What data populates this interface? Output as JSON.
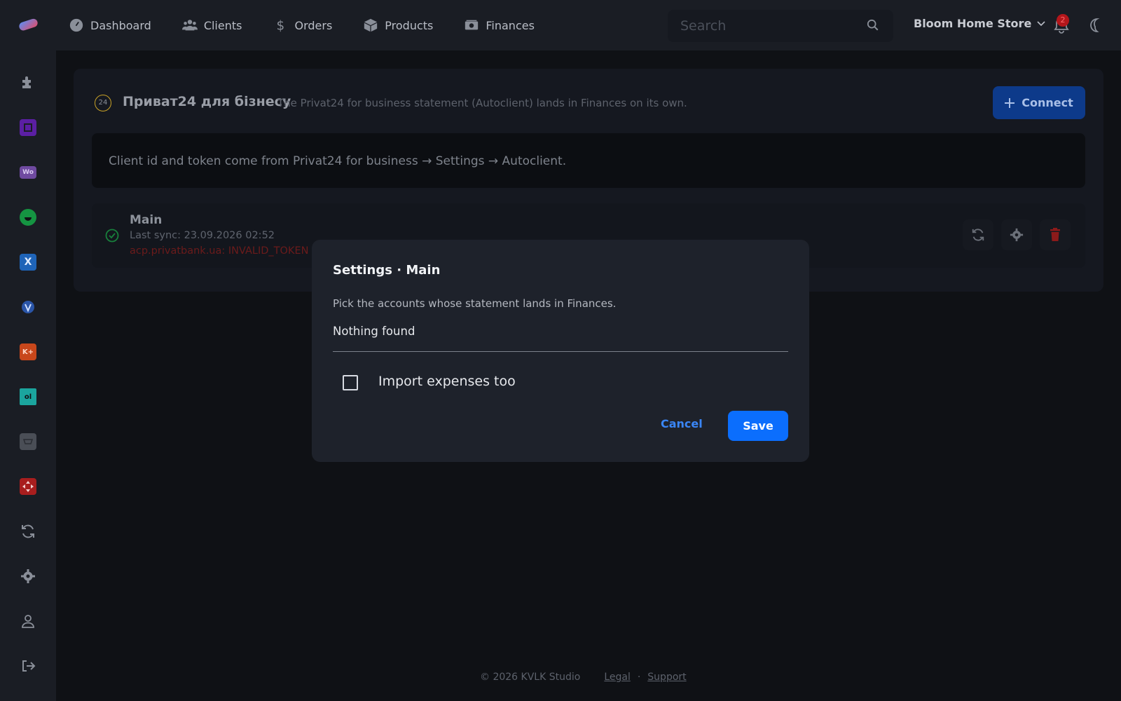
{
  "nav": {
    "items": [
      {
        "label": "Dashboard",
        "icon": "gauge-icon"
      },
      {
        "label": "Clients",
        "icon": "users-icon"
      },
      {
        "label": "Orders",
        "icon": "dollar-icon"
      },
      {
        "label": "Products",
        "icon": "box-icon"
      },
      {
        "label": "Finances",
        "icon": "money-icon"
      }
    ]
  },
  "search": {
    "placeholder": "Search"
  },
  "store": {
    "name": "Bloom Home Store"
  },
  "notifications": {
    "count": "2"
  },
  "sidebar": {
    "items": [
      {
        "name": "puzzle-icon",
        "color": "#8a8f99",
        "text": ""
      },
      {
        "name": "square-app-icon",
        "color": "#7b2ad6",
        "text": ""
      },
      {
        "name": "woo-icon",
        "color": "#7f54b3",
        "text": "Wo"
      },
      {
        "name": "smile-icon",
        "color": "#1aa34a",
        "text": ""
      },
      {
        "name": "x-app-icon",
        "color": "#2a7de1",
        "text": "X"
      },
      {
        "name": "shield-v-icon",
        "color": "#3b6fd8",
        "text": ""
      },
      {
        "name": "k-plus-icon",
        "color": "#e0531f",
        "text": "K+"
      },
      {
        "name": "olx-icon",
        "color": "#23e5db",
        "text": "ol"
      },
      {
        "name": "cart-icon",
        "color": "#6b7079",
        "text": ""
      },
      {
        "name": "nova-icon",
        "color": "#da291c",
        "text": ""
      },
      {
        "name": "sync-icon",
        "color": "#8a8f99",
        "text": ""
      },
      {
        "name": "gear-icon",
        "color": "#8a8f99",
        "text": ""
      },
      {
        "name": "user-icon",
        "color": "#8a8f99",
        "text": ""
      },
      {
        "name": "logout-icon",
        "color": "#8a8f99",
        "text": ""
      }
    ]
  },
  "card": {
    "badge": "24",
    "title": "Приват24 для бізнесу",
    "subtitle": "The Privat24 for business statement (Autoclient) lands in Finances on its own.",
    "connect_label": "Connect",
    "info": "Client id and token come from Privat24 for business → Settings → Autoclient.",
    "connection": {
      "name": "Main",
      "last_sync": "Last sync: 23.09.2026 02:52",
      "error": "acp.privatbank.ua: INVALID_TOKEN"
    }
  },
  "modal": {
    "title": "Settings · Main",
    "description": "Pick the accounts whose statement lands in Finances.",
    "select_value": "Nothing found",
    "checkbox_label": "Import expenses too",
    "checkbox_checked": false,
    "cancel_label": "Cancel",
    "save_label": "Save"
  },
  "footer": {
    "copyright": "© 2026 KVLK Studio",
    "legal": "Legal",
    "separator": "·",
    "support": "Support"
  },
  "colors": {
    "accent": "#0b6efd",
    "danger": "#da2a2a",
    "success": "#1aa34a"
  }
}
